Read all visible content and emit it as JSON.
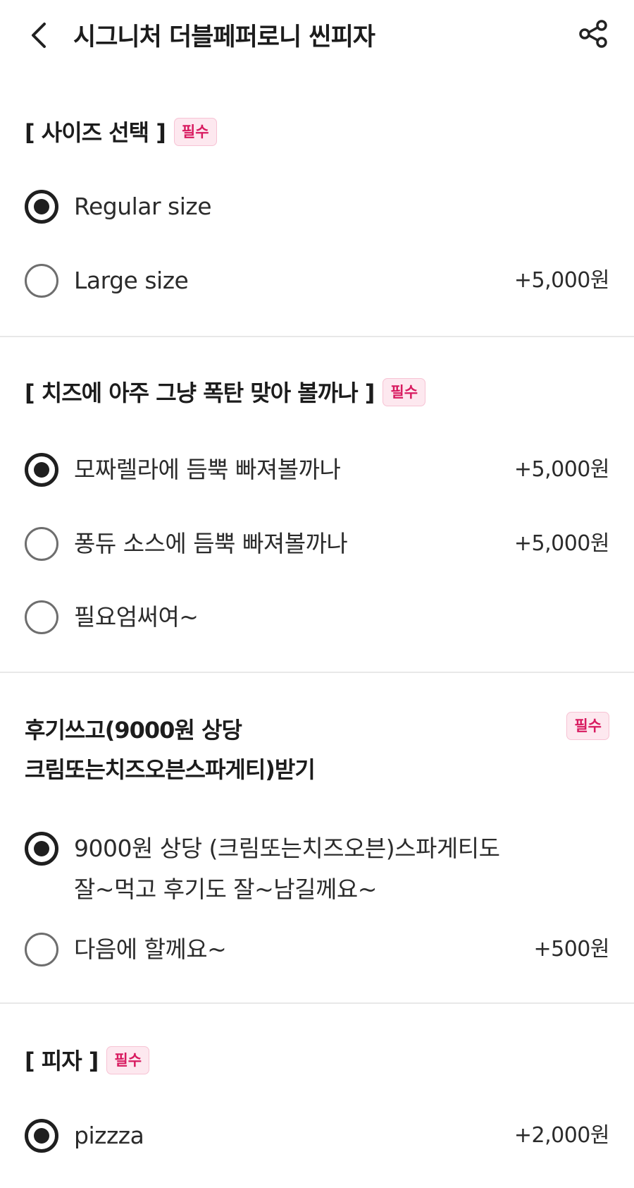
{
  "header": {
    "title": "시그니처 더블페퍼로니 씬피자",
    "back_icon": "chevron-left-icon",
    "share_icon": "share-icon"
  },
  "badge_color": "#d81b60",
  "badge_bg": "#fde8ef",
  "sections": [
    {
      "title": "[ 사이즈 선택 ]",
      "badge": "필수",
      "options": [
        {
          "label": "Regular size",
          "price": "",
          "selected": true
        },
        {
          "label": "Large size",
          "price": "+5,000원",
          "selected": false
        }
      ]
    },
    {
      "title": "[ 치즈에 아주 그냥 폭탄 맞아 볼까나 ]",
      "badge": "필수",
      "options": [
        {
          "label": "모짜렐라에 듬뿍 빠져볼까나",
          "price": "+5,000원",
          "selected": true
        },
        {
          "label": "퐁듀 소스에 듬뿍 빠져볼까나",
          "price": "+5,000원",
          "selected": false
        },
        {
          "label": "필요엄써여~",
          "price": "",
          "selected": false
        }
      ]
    },
    {
      "title_line1": "후기쓰고(9000원 상당",
      "title_line2": "크림또는치즈오븐스파게티)받기",
      "badge": "필수",
      "options": [
        {
          "label_line1": "9000원 상당 (크림또는치즈오븐)스파게티도",
          "label_line2": "잘~먹고 후기도 잘~남길께요~",
          "price": "",
          "selected": true
        },
        {
          "label": "다음에 할께요~",
          "price": "+500원",
          "selected": false
        }
      ]
    },
    {
      "title": "[ 피자 ]",
      "badge": "필수",
      "options": [
        {
          "label": "pizzza",
          "price": "+2,000원",
          "selected": true
        }
      ]
    }
  ]
}
